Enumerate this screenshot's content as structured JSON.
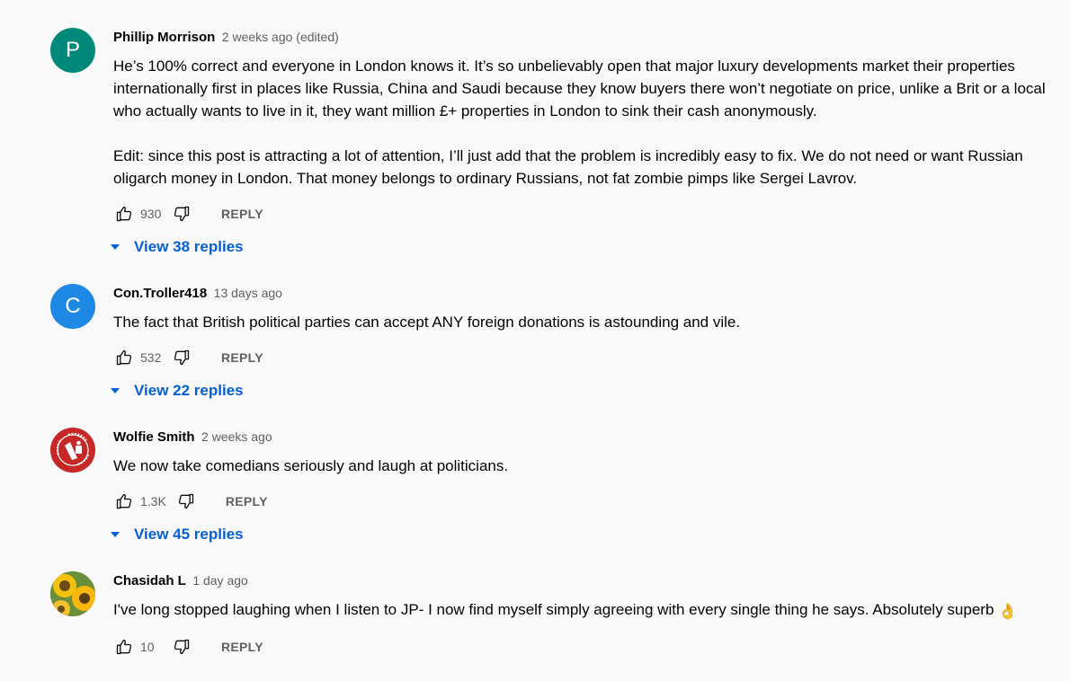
{
  "comments": [
    {
      "author": "Phillip Morrison",
      "time": "2 weeks ago (edited)",
      "avatar_letter": "P",
      "avatar_color": "#00897b",
      "paragraphs": [
        "He’s 100% correct and everyone in London knows it. It’s so unbelievably open that major luxury developments market their properties internationally first in places like Russia, China and Saudi because they know buyers there won’t negotiate on price, unlike a Brit or a local who actually wants to live in it, they want million £+ properties in London to sink their cash anonymously.",
        "Edit: since this post is attracting a lot of attention, I’ll just add that the problem is incredibly easy to fix. We do not need or want Russian oligarch money in London. That money belongs to ordinary Russians, not fat zombie pimps like Sergei Lavrov."
      ],
      "likes": "930",
      "reply_label": "REPLY",
      "view_replies": "View 38 replies"
    },
    {
      "author": "Con.Troller418",
      "time": "13 days ago",
      "avatar_letter": "C",
      "avatar_color": "#1e88e5",
      "paragraphs": [
        "The fact that British political parties can accept ANY foreign donations is astounding and vile."
      ],
      "likes": "532",
      "reply_label": "REPLY",
      "view_replies": "View 22 replies"
    },
    {
      "author": "Wolfie Smith",
      "time": "2 weeks ago",
      "avatar_color": "#c62828",
      "avatar_badge_text": "POWER TO THE PEOPLE",
      "paragraphs": [
        "We now take comedians seriously and laugh at politicians."
      ],
      "likes": "1.3K",
      "reply_label": "REPLY",
      "view_replies": "View 45 replies"
    },
    {
      "author": "Chasidah L",
      "time": "1 day ago",
      "paragraphs": [
        "I've long stopped laughing when I listen to JP- I now find myself simply agreeing with every single thing he says. Absolutely superb"
      ],
      "emoji": "👌",
      "likes": "10",
      "reply_label": "REPLY"
    }
  ],
  "icons": {
    "like": "thumbs-up-icon",
    "dislike": "thumbs-down-icon",
    "expand": "caret-down-icon"
  },
  "colors": {
    "link": "#065fd4",
    "secondary_text": "#606060",
    "background": "#f9f9f9"
  }
}
